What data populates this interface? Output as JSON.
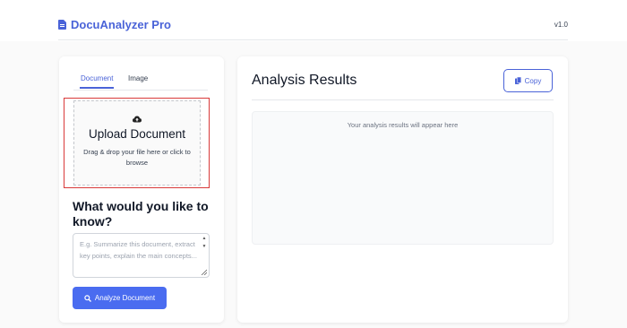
{
  "header": {
    "brand": "DocuAnalyzer Pro",
    "version": "v1.0",
    "brand_icon": "document-icon"
  },
  "left_panel": {
    "tabs": [
      {
        "label": "Document",
        "active": true
      },
      {
        "label": "Image",
        "active": false
      }
    ],
    "upload": {
      "icon": "cloud-upload-icon",
      "title": "Upload Document",
      "hint": "Drag & drop your file here or click to browse"
    },
    "question": "What would you like to know?",
    "textarea_placeholder": "E.g. Summarize this document, extract key points, explain the main concepts...",
    "analyze_button": "Analyze Document",
    "analyze_icon": "search-icon"
  },
  "right_panel": {
    "title": "Analysis Results",
    "copy_button": "Copy",
    "copy_icon": "copy-icon",
    "placeholder": "Your analysis results will appear here"
  },
  "colors": {
    "accent": "#4a63d8",
    "button": "#4a6cf0",
    "highlight_border": "#d93a3a"
  }
}
